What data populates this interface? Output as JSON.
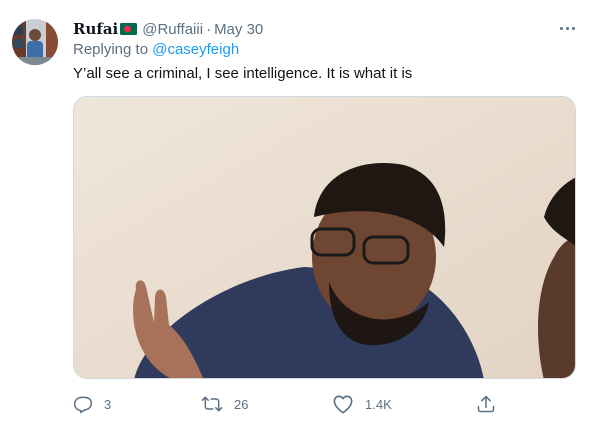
{
  "tweet": {
    "author": {
      "display_name": "Rufai",
      "flag_icon": "bangladesh-flag-icon",
      "handle": "@Ruffaiii",
      "separator": "·",
      "date": "May 30"
    },
    "reply_prefix": "Replying to",
    "reply_handle": "@caseyfeigh",
    "text": "Y’all see a criminal, I see intelligence. It is what it is",
    "actions": {
      "reply_count": "3",
      "retweet_count": "26",
      "like_count": "1.4K"
    },
    "icons": [
      "more-icon",
      "reply-icon",
      "retweet-icon",
      "like-icon",
      "share-icon"
    ],
    "colors": {
      "link": "#1d9bf0",
      "secondary_text": "#5b7083",
      "primary_text": "#0f1419",
      "flag_green": "#006a4e",
      "flag_red": "#f42a41"
    }
  }
}
